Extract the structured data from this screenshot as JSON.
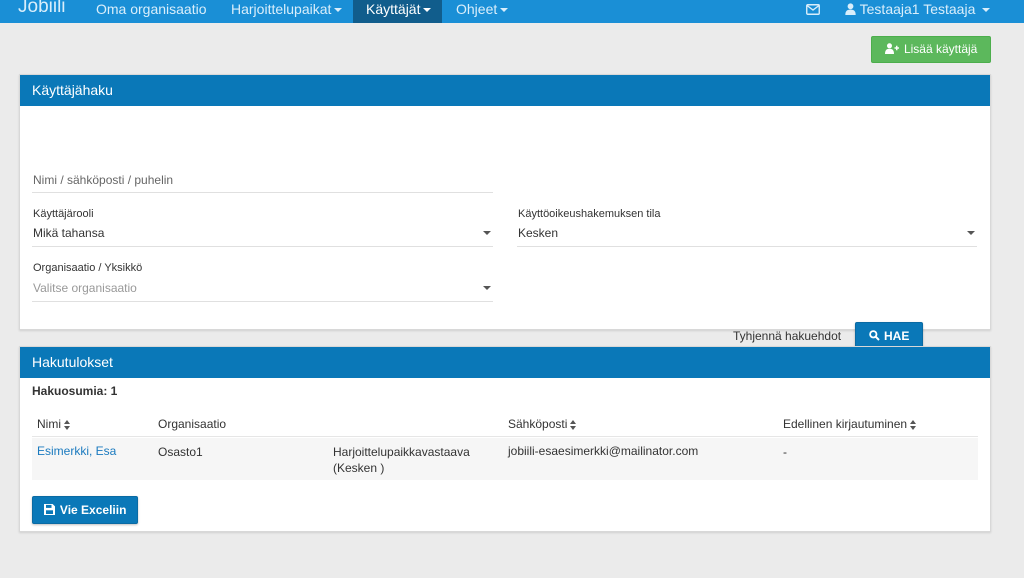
{
  "navbar": {
    "brand": "Jobiili",
    "items": [
      {
        "label": "Oma organisaatio",
        "dropdown": false,
        "active": false
      },
      {
        "label": "Harjoittelupaikat",
        "dropdown": true,
        "active": false
      },
      {
        "label": "Käyttäjät",
        "dropdown": true,
        "active": true
      },
      {
        "label": "Ohjeet",
        "dropdown": true,
        "active": false
      }
    ],
    "mail_icon": "envelope-icon",
    "user_icon": "user-icon",
    "user_label": "Testaaja1 Testaaja"
  },
  "actions": {
    "add_user_label": "Lisää käyttäjä",
    "add_user_icon": "user-plus-icon"
  },
  "search_panel": {
    "title": "Käyttäjähaku",
    "text_search_placeholder": "Nimi / sähköposti / puhelin",
    "role_label": "Käyttäjärooli",
    "role_value": "Mikä tahansa",
    "status_label": "Käyttöoikeushakemuksen tila",
    "status_value": "Kesken",
    "org_label": "Organisaatio / Yksikkö",
    "org_placeholder": "Valitse organisaatio",
    "clear_label": "Tyhjennä hakuehdot",
    "search_label": "HAE",
    "search_icon": "search-icon"
  },
  "results_panel": {
    "title": "Hakutulokset",
    "count_label": "Hakuosumia: 1",
    "columns": [
      {
        "label": "Nimi",
        "sortable": true
      },
      {
        "label": "Organisaatio",
        "sortable": false
      },
      {
        "label": "Sähköposti",
        "sortable": true
      },
      {
        "label": "Edellinen kirjautuminen",
        "sortable": true
      }
    ],
    "rows": [
      {
        "name": "Esimerkki, Esa",
        "organisation": "Osasto1",
        "role_line1": "Harjoittelupaikkavastaava",
        "role_line2": "(Kesken )",
        "email": "jobiili-esaesimerkki@mailinator.com",
        "last_login": "-"
      }
    ],
    "export_label": "Vie Exceliin",
    "export_icon": "floppy-icon"
  },
  "colors": {
    "nav": "#1a8fd6",
    "nav_active": "#115d8c",
    "panel_header": "#0a78b8",
    "success": "#5cb85c",
    "link": "#1a7abf"
  }
}
